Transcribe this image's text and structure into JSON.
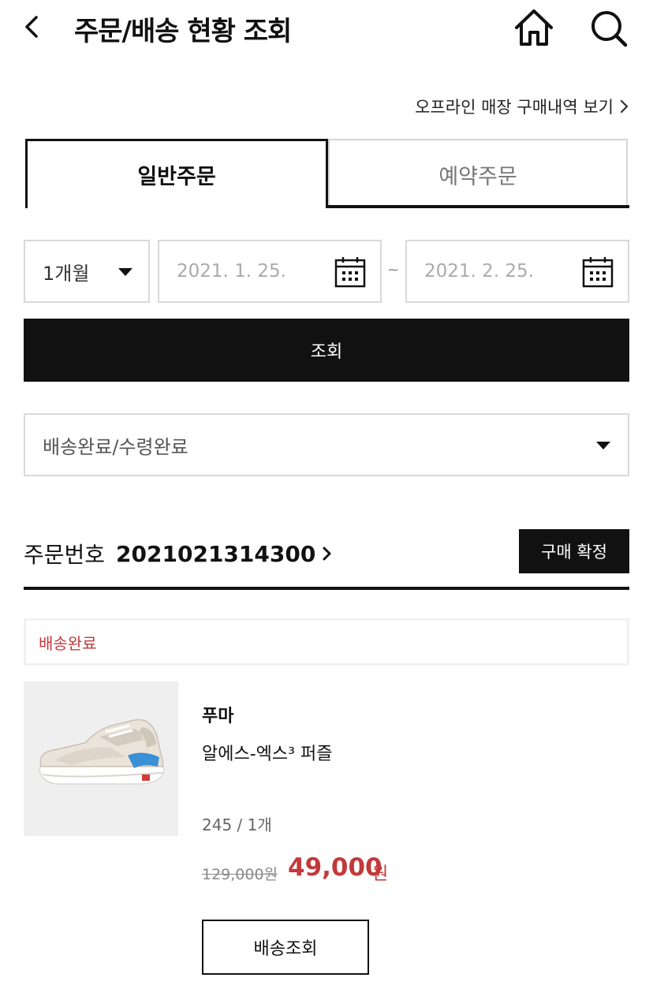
{
  "header": {
    "title": "주문/배송 현황 조회"
  },
  "offline_link": {
    "label": "오프라인 매장 구매내역 보기"
  },
  "tabs": [
    {
      "label": "일반주문",
      "active": true
    },
    {
      "label": "예약주문",
      "active": false
    }
  ],
  "filters": {
    "period": "1개월",
    "date_start": "2021. 1. 25.",
    "date_separator": "~",
    "date_end": "2021. 2. 25.",
    "search_label": "조회",
    "status": "배송완료/수령완료"
  },
  "order": {
    "number_prefix": "주문번호",
    "number": "2021021314300",
    "confirm_label": "구매 확정",
    "status": "배송완료",
    "item": {
      "brand": "푸마",
      "name": "알에스-엑스³ 퍼즐",
      "option": "245 / 1개",
      "original_price": "129,000원",
      "sale_price": "49,000",
      "sale_unit": "원",
      "track_label": "배송조회"
    }
  },
  "colors": {
    "accent_red": "#c3383a",
    "primary_black": "#111111"
  },
  "icons": {
    "back": "chevron-left-icon",
    "home": "home-icon",
    "search": "search-icon",
    "calendar": "calendar-icon",
    "dropdown": "caret-down-icon"
  }
}
